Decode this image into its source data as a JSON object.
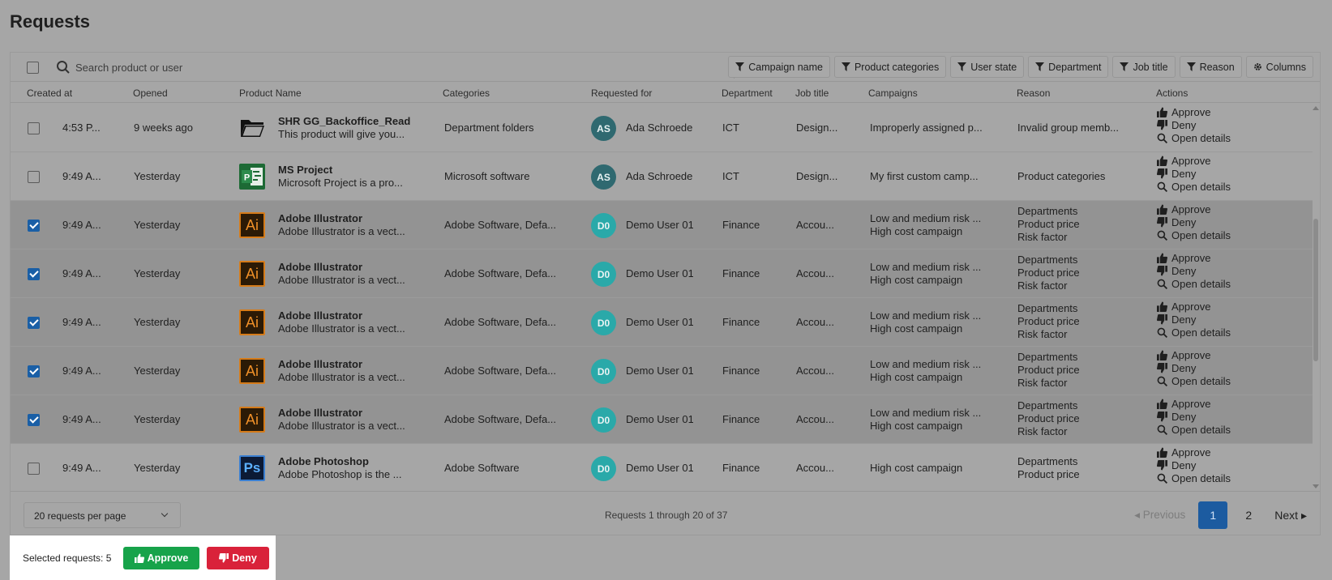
{
  "page": {
    "title": "Requests"
  },
  "toolbar": {
    "search_placeholder": "Search product or user",
    "filters": [
      "Campaign name",
      "Product categories",
      "User state",
      "Department",
      "Job title",
      "Reason"
    ],
    "columns_label": "Columns"
  },
  "columns": [
    "Created at",
    "Opened",
    "Product Name",
    "Categories",
    "Requested for",
    "Department",
    "Job title",
    "Campaigns",
    "Reason",
    "Actions"
  ],
  "action_labels": {
    "approve": "Approve",
    "deny": "Deny",
    "details": "Open details"
  },
  "rows": [
    {
      "selected": false,
      "created": "4:53 P...",
      "opened": "9 weeks ago",
      "icon": "folder-icon",
      "name": "SHR GG_Backoffice_Read",
      "desc": "This product will give you...",
      "categories": "Department folders",
      "avatar": "AS",
      "user": "Ada Schroede",
      "department": "ICT",
      "job": "Design...",
      "campaigns": [
        "Improperly assigned p..."
      ],
      "reasons": [
        "Invalid group memb..."
      ]
    },
    {
      "selected": false,
      "created": "9:49 A...",
      "opened": "Yesterday",
      "icon": "ms-project-icon",
      "name": "MS Project",
      "desc": "Microsoft Project is a pro...",
      "categories": "Microsoft software",
      "avatar": "AS",
      "user": "Ada Schroede",
      "department": "ICT",
      "job": "Design...",
      "campaigns": [
        "My first custom camp..."
      ],
      "reasons": [
        "Product categories"
      ]
    },
    {
      "selected": true,
      "created": "9:49 A...",
      "opened": "Yesterday",
      "icon": "adobe-illustrator-icon",
      "name": "Adobe Illustrator",
      "desc": "Adobe Illustrator is a vect...",
      "categories": "Adobe Software, Defa...",
      "avatar": "D0",
      "user": "Demo User 01",
      "department": "Finance",
      "job": "Accou...",
      "campaigns": [
        "Low and medium risk ...",
        "High cost campaign"
      ],
      "reasons": [
        "Departments",
        "Product price",
        "Risk factor"
      ]
    },
    {
      "selected": true,
      "created": "9:49 A...",
      "opened": "Yesterday",
      "icon": "adobe-illustrator-icon",
      "name": "Adobe Illustrator",
      "desc": "Adobe Illustrator is a vect...",
      "categories": "Adobe Software, Defa...",
      "avatar": "D0",
      "user": "Demo User 01",
      "department": "Finance",
      "job": "Accou...",
      "campaigns": [
        "Low and medium risk ...",
        "High cost campaign"
      ],
      "reasons": [
        "Departments",
        "Product price",
        "Risk factor"
      ]
    },
    {
      "selected": true,
      "created": "9:49 A...",
      "opened": "Yesterday",
      "icon": "adobe-illustrator-icon",
      "name": "Adobe Illustrator",
      "desc": "Adobe Illustrator is a vect...",
      "categories": "Adobe Software, Defa...",
      "avatar": "D0",
      "user": "Demo User 01",
      "department": "Finance",
      "job": "Accou...",
      "campaigns": [
        "Low and medium risk ...",
        "High cost campaign"
      ],
      "reasons": [
        "Departments",
        "Product price",
        "Risk factor"
      ]
    },
    {
      "selected": true,
      "created": "9:49 A...",
      "opened": "Yesterday",
      "icon": "adobe-illustrator-icon",
      "name": "Adobe Illustrator",
      "desc": "Adobe Illustrator is a vect...",
      "categories": "Adobe Software, Defa...",
      "avatar": "D0",
      "user": "Demo User 01",
      "department": "Finance",
      "job": "Accou...",
      "campaigns": [
        "Low and medium risk ...",
        "High cost campaign"
      ],
      "reasons": [
        "Departments",
        "Product price",
        "Risk factor"
      ]
    },
    {
      "selected": true,
      "created": "9:49 A...",
      "opened": "Yesterday",
      "icon": "adobe-illustrator-icon",
      "name": "Adobe Illustrator",
      "desc": "Adobe Illustrator is a vect...",
      "categories": "Adobe Software, Defa...",
      "avatar": "D0",
      "user": "Demo User 01",
      "department": "Finance",
      "job": "Accou...",
      "campaigns": [
        "Low and medium risk ...",
        "High cost campaign"
      ],
      "reasons": [
        "Departments",
        "Product price",
        "Risk factor"
      ]
    },
    {
      "selected": false,
      "created": "9:49 A...",
      "opened": "Yesterday",
      "icon": "adobe-photoshop-icon",
      "name": "Adobe Photoshop",
      "desc": "Adobe Photoshop is the ...",
      "categories": "Adobe Software",
      "avatar": "D0",
      "user": "Demo User 01",
      "department": "Finance",
      "job": "Accou...",
      "campaigns": [
        "High cost campaign"
      ],
      "reasons": [
        "Departments",
        "Product price"
      ]
    }
  ],
  "footer": {
    "per_page": "20 requests per page",
    "range": "Requests 1 through 20 of 37",
    "prev_label": "Previous",
    "pages": [
      "1",
      "2"
    ],
    "current_page": "1",
    "next_label": "Next"
  },
  "bulk": {
    "selected_label": "Selected requests: 5",
    "approve_label": "Approve",
    "deny_label": "Deny"
  },
  "colors": {
    "approve": "#17a34a",
    "deny": "#d9223a",
    "primary": "#1c5ba0",
    "avatar_as": "#2f6970",
    "avatar_do": "#2aa9a9"
  }
}
